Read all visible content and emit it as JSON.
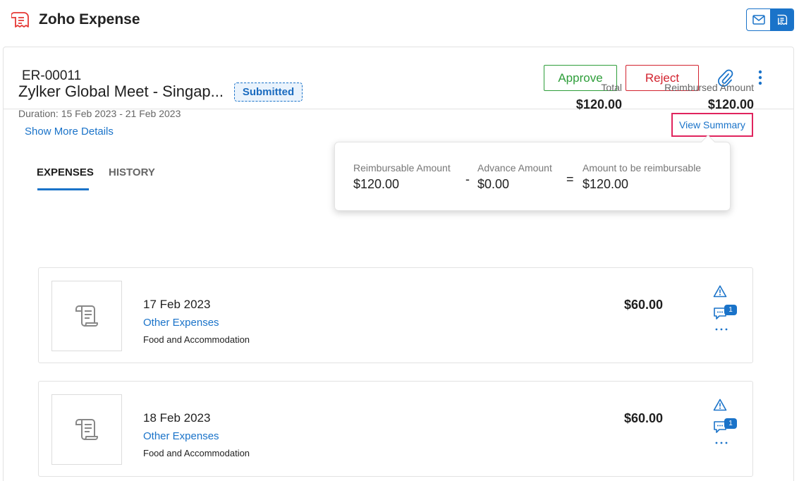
{
  "app": {
    "title": "Zoho Expense",
    "logo_icon": "zoho-expense-logo-icon",
    "brand_color": "#e53935",
    "accent_color": "#1a73c9"
  },
  "header": {
    "buttons": [
      {
        "icon": "mail-icon",
        "active": false
      },
      {
        "icon": "zoho-expense-icon",
        "active": true
      }
    ]
  },
  "report": {
    "id": "ER-00011",
    "approve_label": "Approve",
    "reject_label": "Reject",
    "attach_icon": "paperclip-icon",
    "more_icon": "more-vertical-icon",
    "trip_title": "Zylker Global Meet - Singap...",
    "status": "Submitted",
    "duration": "Duration: 15 Feb 2023 - 21 Feb 2023",
    "show_more": "Show More Details",
    "total_label": "Total",
    "total_value": "$120.00",
    "reimbursed_label": "Reimbursed Amount",
    "reimbursed_value": "$120.00",
    "view_summary": "View Summary"
  },
  "summary": {
    "reimbursable_label": "Reimbursable Amount",
    "reimbursable_value": "$120.00",
    "minus": "-",
    "advance_label": "Advance Amount",
    "advance_value": "$0.00",
    "equals": "=",
    "to_reimburse_label": "Amount to be reimbursable",
    "to_reimburse_value": "$120.00"
  },
  "tabs": [
    {
      "label": "EXPENSES",
      "active": true
    },
    {
      "label": "HISTORY",
      "active": false
    }
  ],
  "expenses": [
    {
      "date": "17 Feb 2023",
      "category": "Other Expenses",
      "description": "Food and Accommodation",
      "amount": "$60.00",
      "comment_count": "1",
      "icons": [
        "receipt-icon",
        "warning-icon",
        "comment-icon",
        "more-horizontal-icon"
      ]
    },
    {
      "date": "18 Feb 2023",
      "category": "Other Expenses",
      "description": "Food and Accommodation",
      "amount": "$60.00",
      "comment_count": "1",
      "icons": [
        "receipt-icon",
        "warning-icon",
        "comment-icon",
        "more-horizontal-icon"
      ]
    }
  ]
}
